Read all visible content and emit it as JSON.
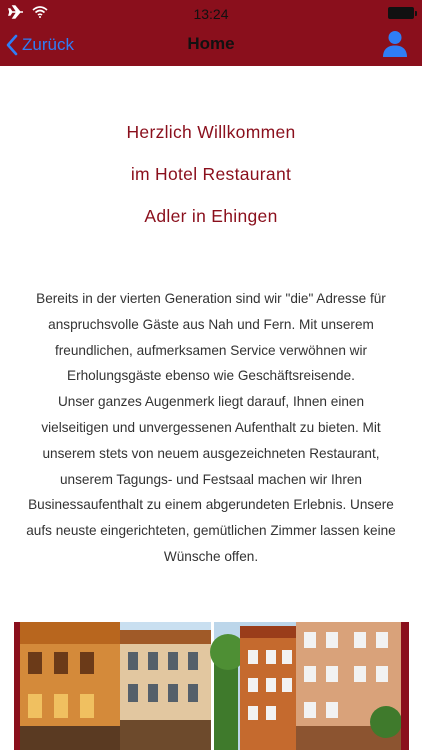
{
  "status_bar": {
    "time": "13:24",
    "icons": [
      "airplane-icon",
      "wifi-icon",
      "battery-icon"
    ]
  },
  "nav": {
    "back_label": "Zurück",
    "title": "Home",
    "profile_icon": "person-icon"
  },
  "welcome": {
    "line1": "Herzlich Willkommen",
    "line2": "im Hotel Restaurant",
    "line3": "Adler in Ehingen"
  },
  "intro_lines": [
    "Bereits in der vierten Generation sind wir \"die\" Adresse für",
    "anspruchsvolle Gäste aus Nah und Fern. Mit unserem",
    "freundlichen, aufmerksamen Service verwöhnen wir",
    "Erholungsgäste ebenso wie Geschäftsreisende.",
    "Unser ganzes Augenmerk liegt darauf, Ihnen einen",
    "vielseitigen und unvergessenen Aufenthalt zu bieten. Mit",
    "unserem stets von neuem ausgezeichneten Restaurant,",
    "unserem Tagungs- und Festsaal machen wir Ihren",
    "Businessaufenthalt zu einem abgerundeten Erlebnis. Unsere",
    "aufs neuste eingerichteten, gemütlichen Zimmer lassen keine",
    "Wünsche offen."
  ],
  "colors": {
    "header_background": "#8a0f1c",
    "accent_blue": "#2f7ef6",
    "welcome_text": "#8a0f1c"
  }
}
